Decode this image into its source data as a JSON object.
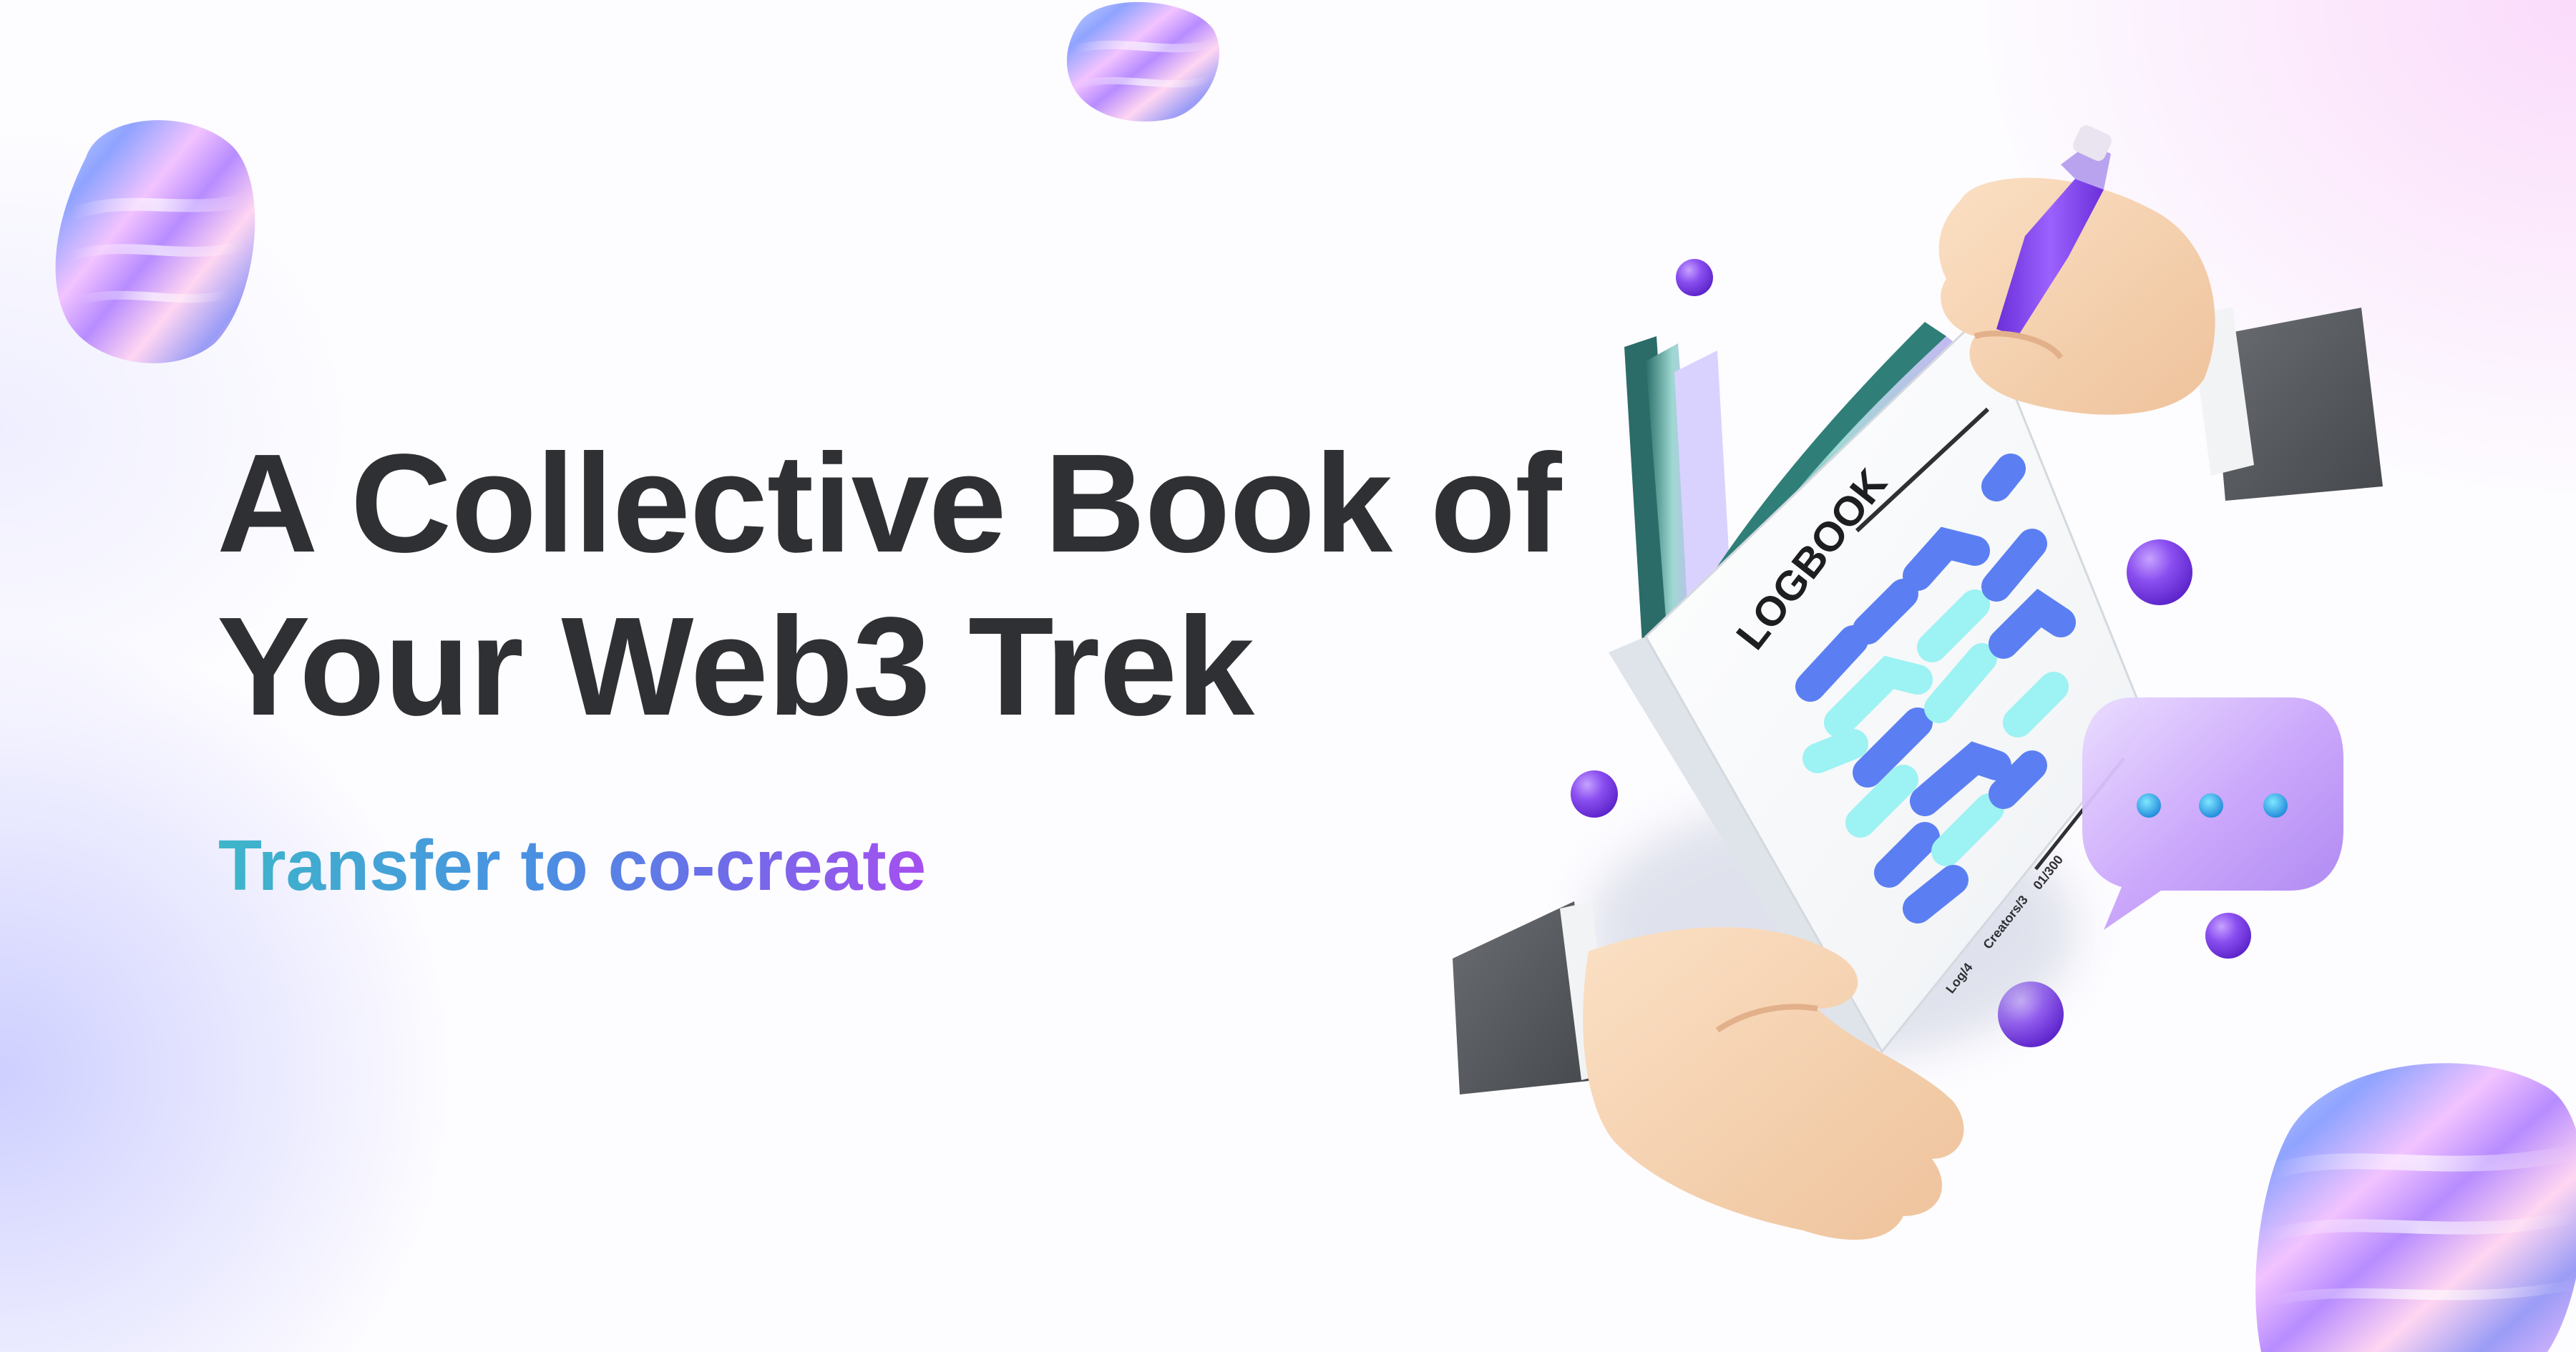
{
  "hero": {
    "headline_line1": "A Collective Book of",
    "headline_line2": "Your Web3 Trek",
    "subtitle": "Transfer to co-create"
  },
  "book": {
    "cover_title": "LOGBOOK",
    "footer_1": "Log/4",
    "footer_2": "Creators/3",
    "footer_3": "01/300"
  },
  "colors": {
    "headline": "#2f3033",
    "subtitle_gradient": [
      "#3db6c9",
      "#4a90e2",
      "#6b6ee8",
      "#a64ff0"
    ],
    "accent_purple": "#8a4cf0",
    "book_pattern_blue": "#5b7ff2",
    "book_pattern_cyan": "#9df2f3"
  },
  "icons": {
    "chat_bubble": "chat-bubble-icon",
    "pen": "pen-icon",
    "blob": "iridescent-blob"
  }
}
